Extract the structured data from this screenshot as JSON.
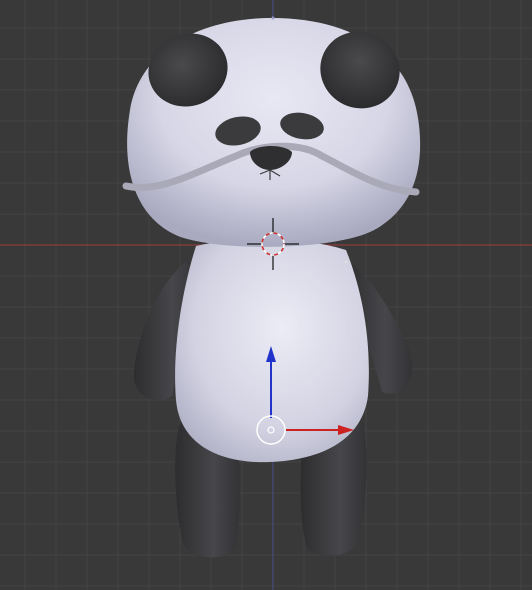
{
  "viewport": {
    "view": "front-ortho",
    "background": "#393939",
    "grid_color": "#444444",
    "x_axis_color": "#9a3d3d",
    "z_axis_color": "#4a4f7e"
  },
  "model": {
    "name_icon": "panda-model",
    "body_color": "#dcdcec",
    "patch_color": "#3b3b3d"
  },
  "cursor": {
    "icon": "3d-cursor-icon",
    "ring_color_a": "#cc3333",
    "ring_color_b": "#ffffff"
  },
  "manipulator": {
    "icon": "translate-manipulator-icon",
    "x_color": "#cc2222",
    "z_color": "#2233cc",
    "center_color": "#ffffff"
  }
}
